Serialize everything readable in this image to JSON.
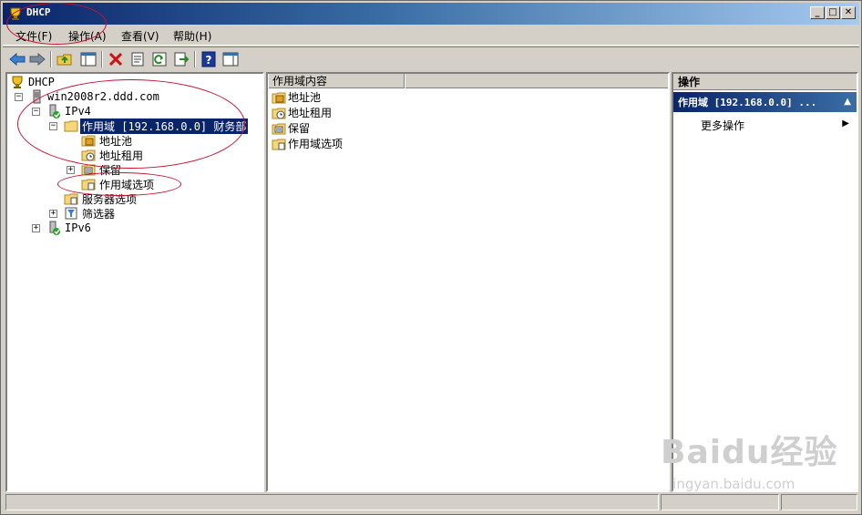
{
  "window": {
    "title": "DHCP",
    "controls": [
      "_",
      "□",
      "✕"
    ]
  },
  "menu": [
    {
      "label": "文件(F)"
    },
    {
      "label": "操作(A)"
    },
    {
      "label": "查看(V)"
    },
    {
      "label": "帮助(H)"
    }
  ],
  "toolbar": {
    "icons": [
      "back-icon",
      "forward-icon",
      "up-folder-icon",
      "show-hide-tree-icon",
      "delete-icon",
      "properties-icon",
      "refresh-icon",
      "export-icon",
      "help-icon",
      "show-hide-action-pane-icon"
    ]
  },
  "tree": {
    "root": "DHCP",
    "server": "win2008r2.ddd.com",
    "ipv4": "IPv4",
    "scope": "作用域 [192.168.0.0] 财务部",
    "address_pool": "地址池",
    "address_leases": "地址租用",
    "reservations": "保留",
    "scope_options": "作用域选项",
    "server_options": "服务器选项",
    "filters": "筛选器",
    "ipv6": "IPv6"
  },
  "list": {
    "column_header": "作用域内容",
    "items": [
      "地址池",
      "地址租用",
      "保留",
      "作用域选项"
    ]
  },
  "actions": {
    "header": "操作",
    "scope": "作用域 [192.168.0.0] ...",
    "more_actions": "更多操作"
  },
  "watermark": {
    "brand": "Baidu经验",
    "url": "jingyan.baidu.com"
  },
  "colors": {
    "annotation": "#c8102e",
    "selection": "#0a246a"
  }
}
